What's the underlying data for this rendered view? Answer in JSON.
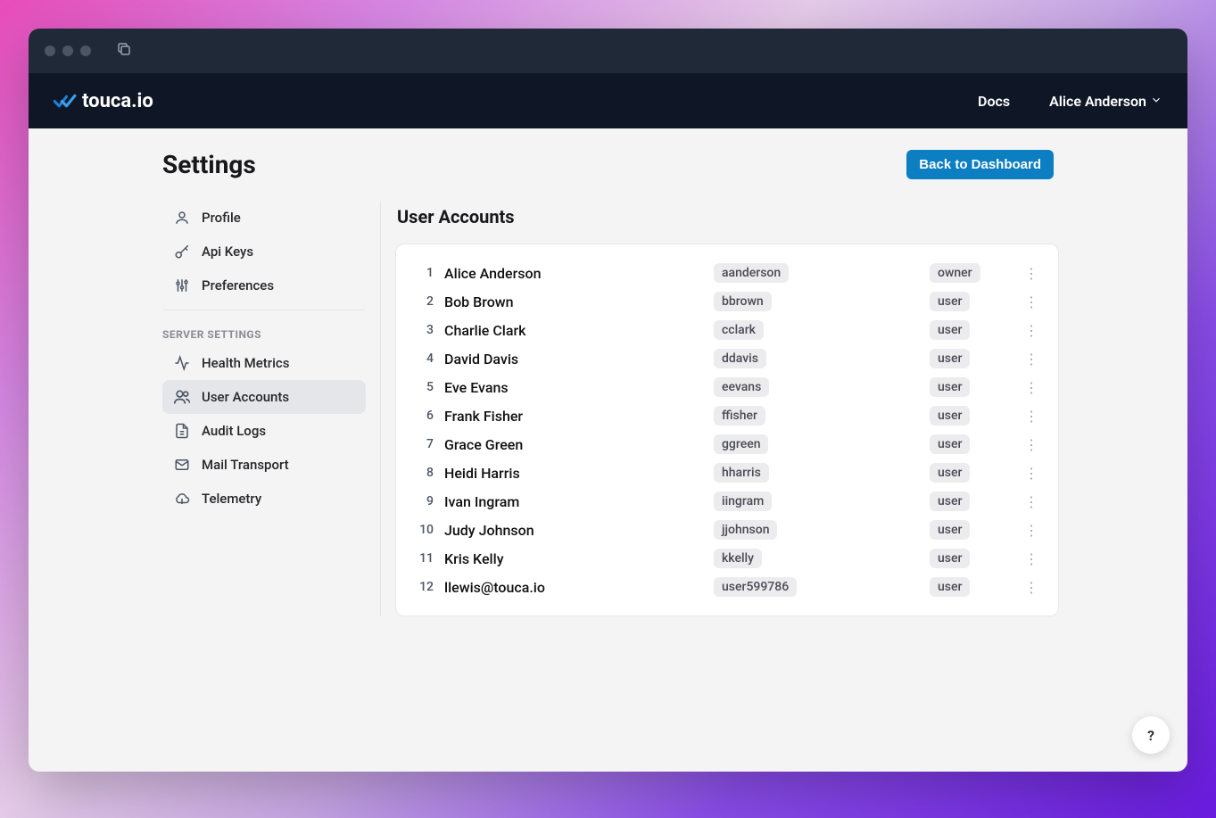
{
  "brand": {
    "name": "touca.io"
  },
  "header": {
    "docs_label": "Docs",
    "user_name": "Alice Anderson"
  },
  "page": {
    "title": "Settings",
    "back_button": "Back to Dashboard"
  },
  "sidebar": {
    "items_top": [
      {
        "id": "profile",
        "label": "Profile"
      },
      {
        "id": "api-keys",
        "label": "Api Keys"
      },
      {
        "id": "preferences",
        "label": "Preferences"
      }
    ],
    "section_label": "SERVER SETTINGS",
    "items_bottom": [
      {
        "id": "health-metrics",
        "label": "Health Metrics"
      },
      {
        "id": "user-accounts",
        "label": "User Accounts",
        "active": true
      },
      {
        "id": "audit-logs",
        "label": "Audit Logs"
      },
      {
        "id": "mail-transport",
        "label": "Mail Transport"
      },
      {
        "id": "telemetry",
        "label": "Telemetry"
      }
    ]
  },
  "section": {
    "title": "User Accounts"
  },
  "accounts": [
    {
      "idx": "1",
      "name": "Alice Anderson",
      "username": "aanderson",
      "role": "owner"
    },
    {
      "idx": "2",
      "name": "Bob Brown",
      "username": "bbrown",
      "role": "user"
    },
    {
      "idx": "3",
      "name": "Charlie Clark",
      "username": "cclark",
      "role": "user"
    },
    {
      "idx": "4",
      "name": "David Davis",
      "username": "ddavis",
      "role": "user"
    },
    {
      "idx": "5",
      "name": "Eve Evans",
      "username": "eevans",
      "role": "user"
    },
    {
      "idx": "6",
      "name": "Frank Fisher",
      "username": "ffisher",
      "role": "user"
    },
    {
      "idx": "7",
      "name": "Grace Green",
      "username": "ggreen",
      "role": "user"
    },
    {
      "idx": "8",
      "name": "Heidi Harris",
      "username": "hharris",
      "role": "user"
    },
    {
      "idx": "9",
      "name": "Ivan Ingram",
      "username": "iingram",
      "role": "user"
    },
    {
      "idx": "10",
      "name": "Judy Johnson",
      "username": "jjohnson",
      "role": "user"
    },
    {
      "idx": "11",
      "name": "Kris Kelly",
      "username": "kkelly",
      "role": "user"
    },
    {
      "idx": "12",
      "name": "llewis@touca.io",
      "username": "user599786",
      "role": "user"
    }
  ],
  "help": {
    "label": "?"
  },
  "colors": {
    "accent": "#0c7ec2"
  }
}
